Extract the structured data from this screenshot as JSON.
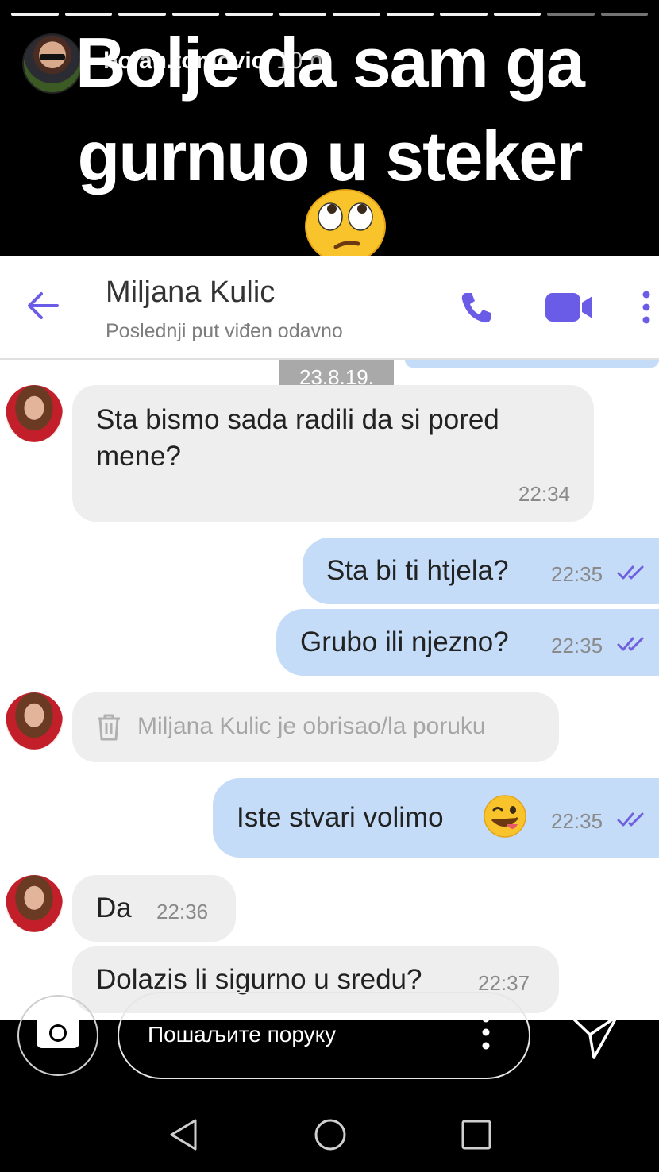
{
  "story": {
    "progress_segments": 12,
    "viewed_segments": 10,
    "username": "bojan.tomovic",
    "time_ago": "10 h",
    "caption_line1": "Bolje da sam ga",
    "caption_line2": "gurnuo u steker",
    "caption_emoji": "face-with-rolling-eyes"
  },
  "chat": {
    "contact_name": "Miljana Kulic",
    "last_seen": "Poslednji put viđen odavno",
    "date_label": "23.8.19.",
    "accent_color": "#7060e0",
    "outgoing_bubble_color": "#c4dcf8",
    "incoming_bubble_color": "#eeeeee",
    "messages": [
      {
        "direction": "incoming",
        "line1": "Sta bismo sada radili da si pored",
        "line2": "mene?",
        "time": "22:34"
      },
      {
        "direction": "outgoing",
        "text": "Sta bi ti htjela?",
        "time": "22:35",
        "read": true
      },
      {
        "direction": "outgoing",
        "text": "Grubo ili njezno?",
        "time": "22:35",
        "read": true
      },
      {
        "direction": "incoming",
        "deleted": true,
        "text": "Miljana Kulic je obrisao/la poruku"
      },
      {
        "direction": "outgoing",
        "text": "Iste stvari volimo",
        "emoji": "winking-face-with-tongue",
        "time": "22:35",
        "read": true
      },
      {
        "direction": "incoming",
        "text": "Da",
        "time": "22:36"
      },
      {
        "direction": "incoming",
        "text": "Dolazis li sigurno u sredu?",
        "time": "22:37"
      }
    ]
  },
  "reply": {
    "placeholder": "Пошаљите поруку"
  },
  "icons": [
    "back-arrow-icon",
    "phone-icon",
    "video-camera-icon",
    "more-vertical-icon",
    "trash-icon",
    "double-check-icon",
    "camera-icon",
    "send-icon",
    "nav-back-icon",
    "nav-home-icon",
    "nav-recent-icon"
  ]
}
